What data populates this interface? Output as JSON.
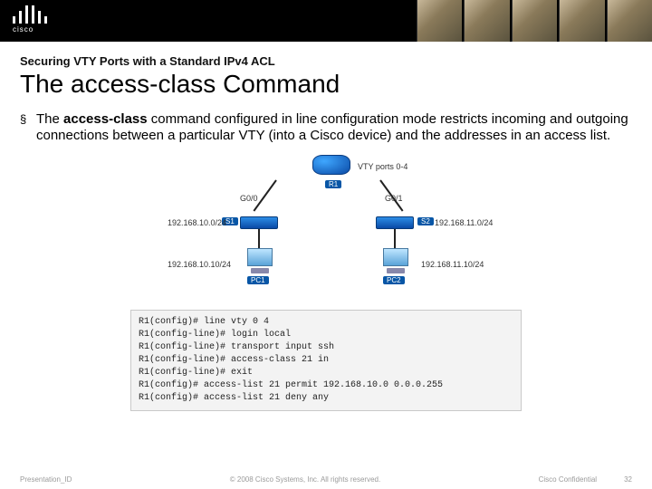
{
  "header": {
    "brand": "cisco"
  },
  "kicker": "Securing VTY Ports with a Standard IPv4 ACL",
  "title": "The access-class Command",
  "bullet": {
    "emph": "access-class",
    "prefix": "The ",
    "suffix": " command configured in line configuration mode restricts incoming and outgoing connections between a particular VTY (into a Cisco device) and the addresses in an access list."
  },
  "diagram": {
    "vty_label": "VTY ports 0-4",
    "router": "R1",
    "g00": "G0/0",
    "g01": "G0/1",
    "s1": "S1",
    "s2": "S2",
    "net_left": "192.168.10.0/24",
    "net_right": "192.168.11.0/24",
    "pc1": "PC1",
    "pc2": "PC2",
    "host_left": "192.168.10.10/24",
    "host_right": "192.168.11.10/24"
  },
  "cli": {
    "l1": "R1(config)# line vty 0 4",
    "l2": "R1(config-line)# login local",
    "l3": "R1(config-line)# transport input ssh",
    "l4": "R1(config-line)# access-class 21 in",
    "l5": "R1(config-line)# exit",
    "l6": "R1(config)# access-list 21 permit 192.168.10.0 0.0.0.255",
    "l7": "R1(config)# access-list 21 deny any"
  },
  "footer": {
    "left": "Presentation_ID",
    "center": "© 2008 Cisco Systems, Inc. All rights reserved.",
    "conf": "Cisco Confidential",
    "page": "32"
  }
}
